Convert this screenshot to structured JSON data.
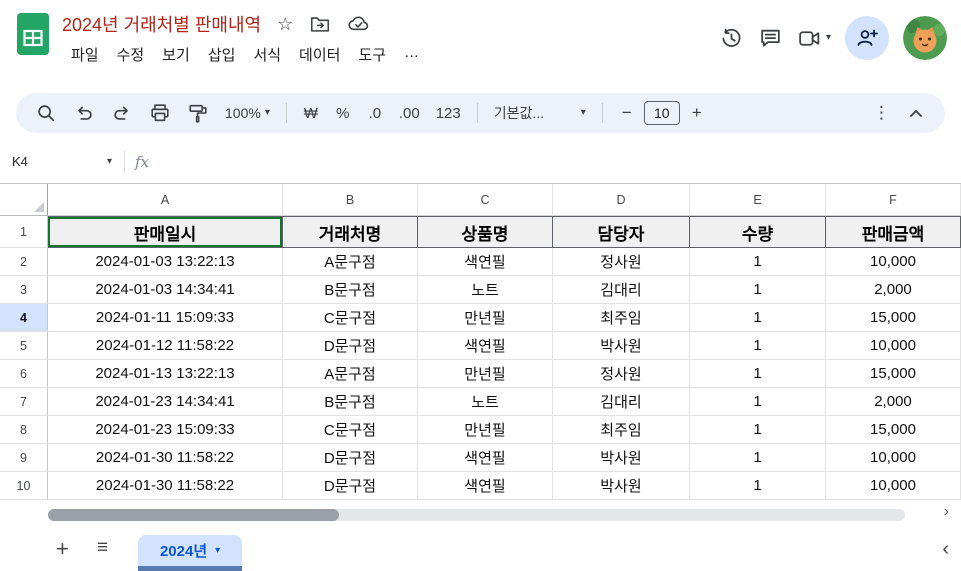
{
  "header": {
    "title": "2024년 거래처별 판매내역",
    "menus": [
      "파일",
      "수정",
      "보기",
      "삽입",
      "서식",
      "데이터",
      "도구",
      "…"
    ]
  },
  "toolbar": {
    "zoom": "100%",
    "currency_label": "₩",
    "percent_label": "%",
    "decrease_decimal_label": ".0",
    "increase_decimal_label": ".00",
    "number_format_label": "123",
    "font_name": "기본값...",
    "minus": "−",
    "font_size": "10",
    "plus": "+"
  },
  "formula_bar": {
    "cell_reference": "K4",
    "fx_label": "fx"
  },
  "grid": {
    "column_letters": [
      "A",
      "B",
      "C",
      "D",
      "E",
      "F"
    ],
    "row_numbers": [
      "1",
      "2",
      "3",
      "4",
      "5",
      "6",
      "7",
      "8",
      "9",
      "10"
    ],
    "header_row": [
      "판매일시",
      "거래처명",
      "상품명",
      "담당자",
      "수량",
      "판매금액"
    ],
    "data_rows": [
      [
        "2024-01-03 13:22:13",
        "A문구점",
        "색연필",
        "정사원",
        "1",
        "10,000"
      ],
      [
        "2024-01-03 14:34:41",
        "B문구점",
        "노트",
        "김대리",
        "1",
        "2,000"
      ],
      [
        "2024-01-11 15:09:33",
        "C문구점",
        "만년필",
        "최주임",
        "1",
        "15,000"
      ],
      [
        "2024-01-12 11:58:22",
        "D문구점",
        "색연필",
        "박사원",
        "1",
        "10,000"
      ],
      [
        "2024-01-13 13:22:13",
        "A문구점",
        "만년필",
        "정사원",
        "1",
        "15,000"
      ],
      [
        "2024-01-23 14:34:41",
        "B문구점",
        "노트",
        "김대리",
        "1",
        "2,000"
      ],
      [
        "2024-01-23 15:09:33",
        "C문구점",
        "만년필",
        "최주임",
        "1",
        "15,000"
      ],
      [
        "2024-01-30 11:58:22",
        "D문구점",
        "색연필",
        "박사원",
        "1",
        "10,000"
      ],
      [
        "2024-01-30 11:58:22",
        "D문구점",
        "색연필",
        "박사원",
        "1",
        "10,000"
      ]
    ],
    "active_row_number": "4",
    "selected_cell": "K4"
  },
  "sheet_bar": {
    "active_tab": "2024년"
  },
  "icons": {
    "star": "☆",
    "more_vertical": "⋮",
    "caret_down": "▾",
    "plus": "+",
    "all_sheets": "≡",
    "chevron_left": "‹",
    "scroll_right": "›"
  },
  "colors": {
    "title_text": "#b02418",
    "logo_green": "#23a566",
    "toolbar_bg": "#edf2fa",
    "accent_blue": "#0b57d0",
    "selection_bg": "#d3e3fd",
    "header_row_bg": "#f0f0f0",
    "a1_border": "#137333"
  }
}
